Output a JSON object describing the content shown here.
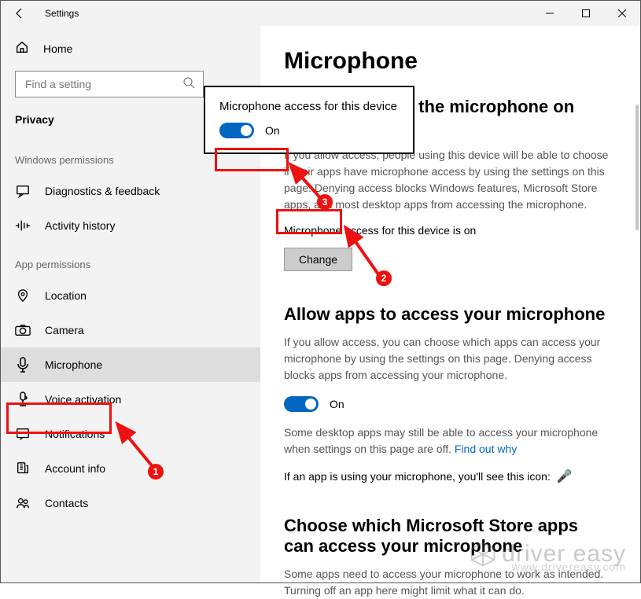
{
  "titlebar": {
    "title": "Settings"
  },
  "sidebar": {
    "home": "Home",
    "search_placeholder": "Find a setting",
    "group": "Privacy",
    "section_win": "Windows permissions",
    "section_app": "App permissions",
    "items_win": [
      {
        "label": "Diagnostics & feedback"
      },
      {
        "label": "Activity history"
      }
    ],
    "items_app": [
      {
        "label": "Location"
      },
      {
        "label": "Camera"
      },
      {
        "label": "Microphone"
      },
      {
        "label": "Voice activation"
      },
      {
        "label": "Notifications"
      },
      {
        "label": "Account info"
      },
      {
        "label": "Contacts"
      }
    ]
  },
  "main": {
    "title": "Microphone",
    "sect1_title": "Allow access to the microphone on this device",
    "sect1_desc": "If you allow access, people using this device will be able to choose if their apps have microphone access by using the settings on this page. Denying access blocks Windows features, Microsoft Store apps, and most desktop apps from accessing the microphone.",
    "sect1_status": "Microphone access for this device is on",
    "change_label": "Change",
    "sect2_title": "Allow apps to access your microphone",
    "sect2_desc": "If you allow access, you can choose which apps can access your microphone by using the settings on this page. Denying access blocks apps from accessing your microphone.",
    "toggle2_label": "On",
    "sect2_note1": "Some desktop apps may still be able to access your microphone when settings on this page are off. ",
    "sect2_link": "Find out why",
    "sect2_note2": "If an app is using your microphone, you'll see this icon:",
    "sect3_title": "Choose which Microsoft Store apps can access your microphone",
    "sect3_desc": "Some apps need to access your microphone to work as intended. Turning off an app here might limit what it can do."
  },
  "popup": {
    "title": "Microphone access for this device",
    "toggle_label": "On"
  },
  "annotations": {
    "b1": "1",
    "b2": "2",
    "b3": "3"
  },
  "watermark": {
    "brand": "driver easy",
    "sub": "www.drivereasy.com"
  }
}
